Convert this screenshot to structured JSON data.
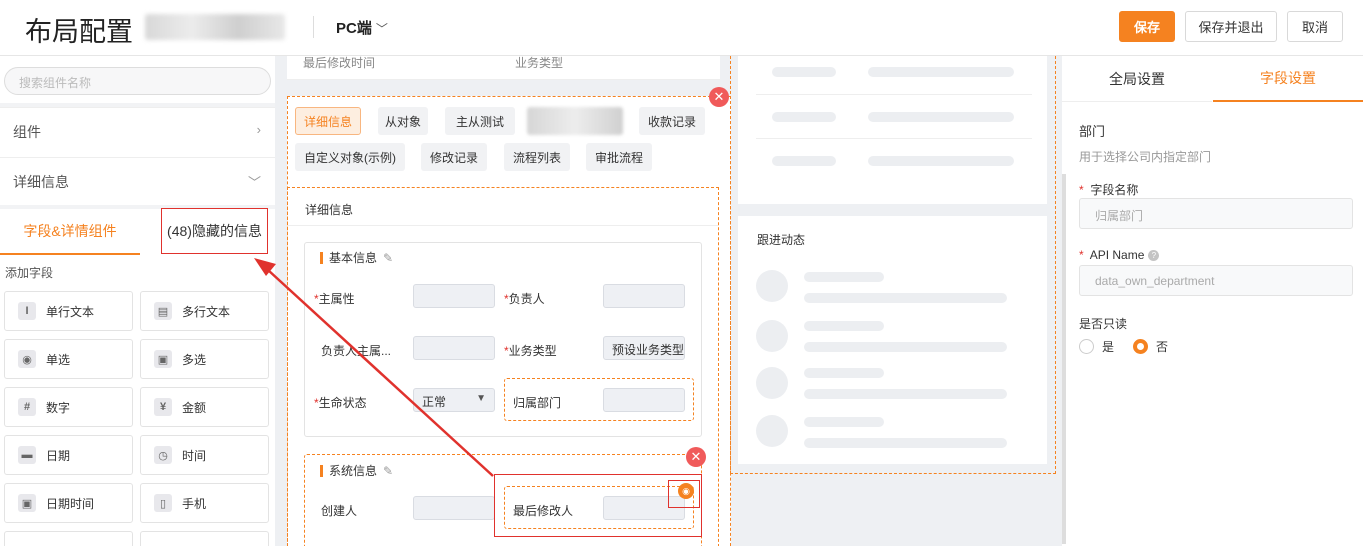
{
  "header": {
    "title": "布局配置",
    "device": "PC端",
    "save": "保存",
    "save_exit": "保存并退出",
    "cancel": "取消"
  },
  "left": {
    "search_placeholder": "搜索组件名称",
    "sections": [
      "组件",
      "详细信息"
    ],
    "tab_fields": "字段&详情组件",
    "tab_hidden": "(48)隐藏的信息",
    "add_field": "添加字段",
    "fields": [
      {
        "label": "单行文本",
        "icon": "I"
      },
      {
        "label": "多行文本",
        "icon": "▤"
      },
      {
        "label": "单选",
        "icon": "◉"
      },
      {
        "label": "多选",
        "icon": "▣"
      },
      {
        "label": "数字",
        "icon": "#"
      },
      {
        "label": "金额",
        "icon": "¥"
      },
      {
        "label": "日期",
        "icon": "▬"
      },
      {
        "label": "时间",
        "icon": "◷"
      },
      {
        "label": "日期时间",
        "icon": "▣"
      },
      {
        "label": "手机",
        "icon": "▯"
      }
    ]
  },
  "canvas": {
    "top_fields": [
      "最后修改时间",
      "业务类型"
    ],
    "tabs": [
      "详细信息",
      "从对象",
      "主从测试",
      "收款记录",
      "自定义对象(示例)",
      "修改记录",
      "流程列表",
      "审批流程"
    ],
    "section_title": "详细信息",
    "basic": {
      "title": "基本信息",
      "fields": [
        {
          "label": "主属性",
          "required": true,
          "value": ""
        },
        {
          "label": "负责人",
          "required": true,
          "value": ""
        },
        {
          "label": "负责人主属...",
          "required": false,
          "value": ""
        },
        {
          "label": "业务类型",
          "required": true,
          "value": "预设业务类型"
        },
        {
          "label": "生命状态",
          "required": true,
          "value": "正常"
        },
        {
          "label": "归属部门",
          "required": false,
          "value": ""
        }
      ]
    },
    "system": {
      "title": "系统信息",
      "fields": [
        {
          "label": "创建人",
          "value": ""
        },
        {
          "label": "最后修改人",
          "value": ""
        }
      ]
    },
    "follow_title": "跟进动态"
  },
  "right": {
    "tab_global": "全局设置",
    "tab_field": "字段设置",
    "field_title": "部门",
    "field_desc": "用于选择公司内指定部门",
    "name_label": "字段名称",
    "name_value": "归属部门",
    "api_label": "API Name",
    "api_value": "data_own_department",
    "readonly_label": "是否只读",
    "opt_yes": "是",
    "opt_no": "否",
    "readonly_selected": "否"
  },
  "colors": {
    "accent": "#f58220",
    "danger": "#e0322d"
  }
}
